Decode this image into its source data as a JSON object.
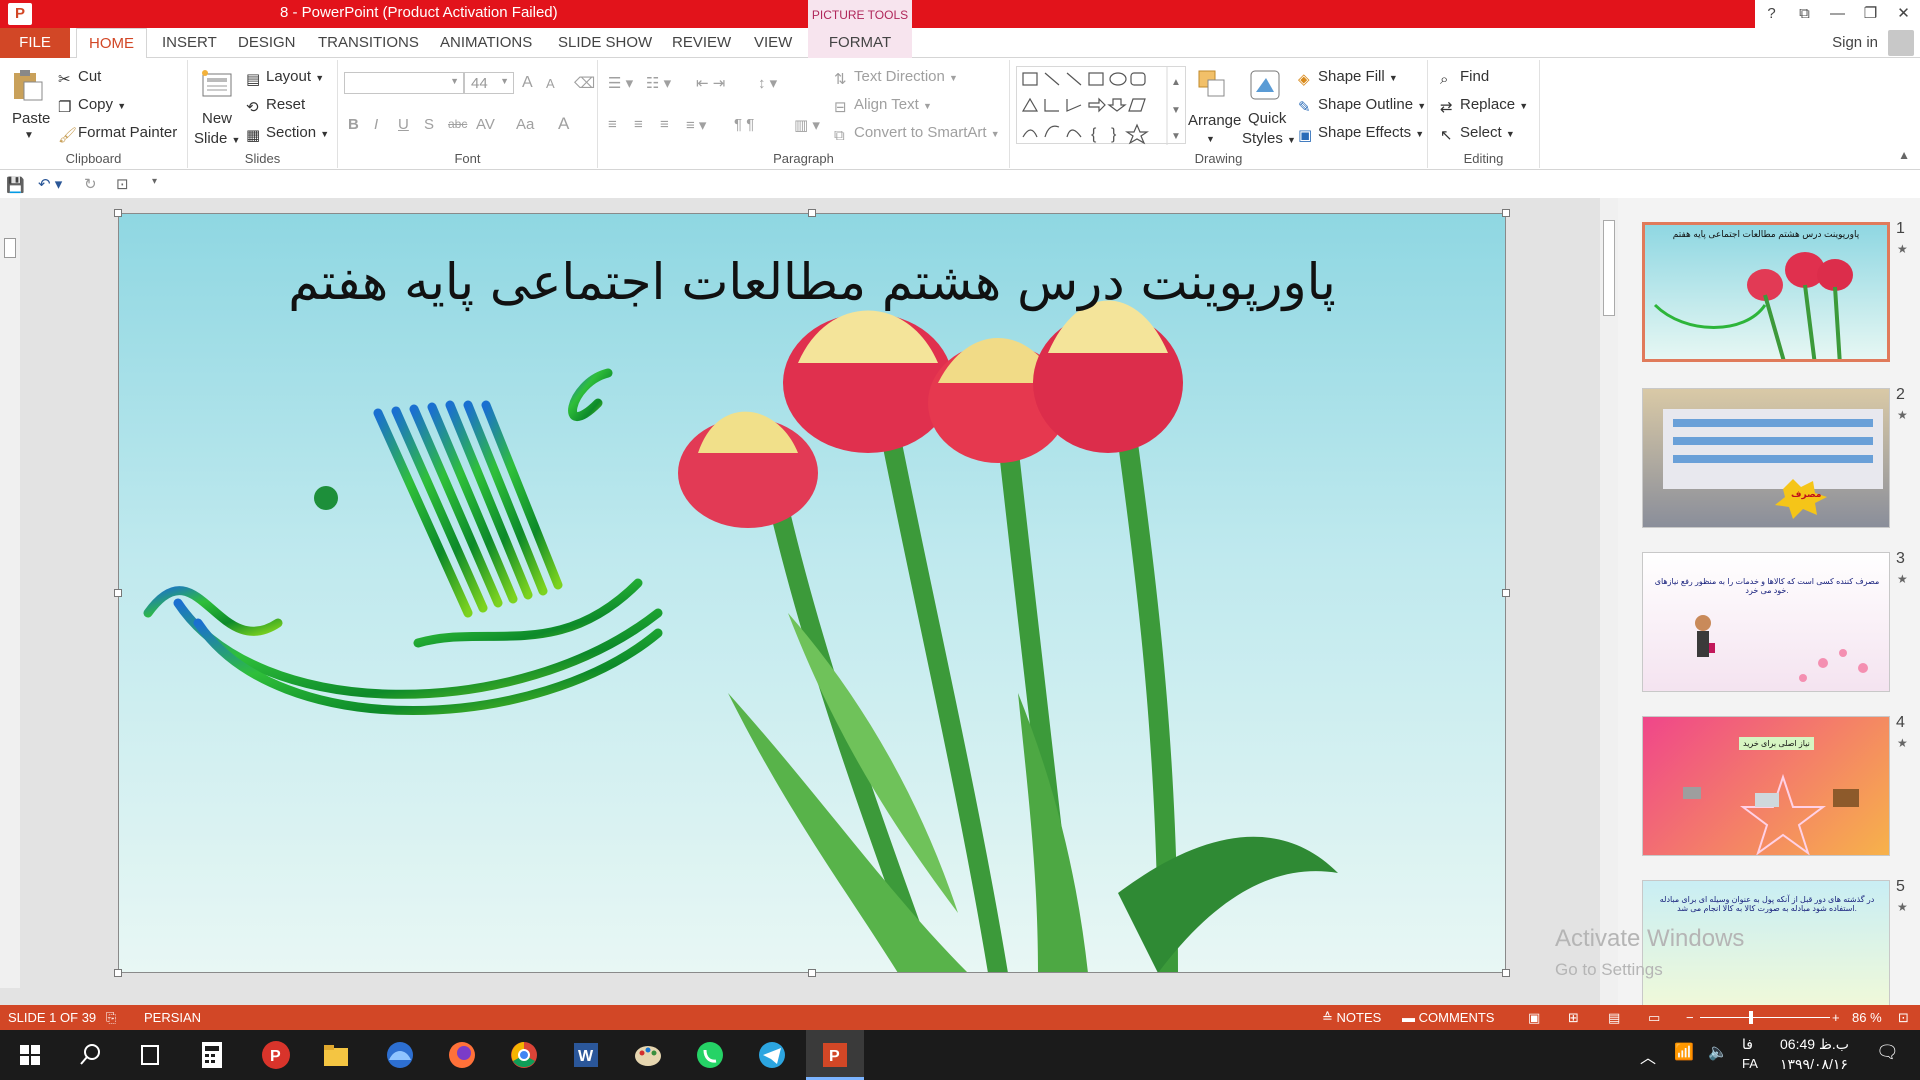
{
  "window": {
    "title": "8 -  PowerPoint (Product Activation Failed)",
    "context_tab": "PICTURE TOOLS",
    "help": "?",
    "restore_ribbon": "⧉",
    "minimize": "—",
    "maximize": "❐",
    "close": "✕"
  },
  "tabs": [
    "FILE",
    "HOME",
    "INSERT",
    "DESIGN",
    "TRANSITIONS",
    "ANIMATIONS",
    "SLIDE SHOW",
    "REVIEW",
    "VIEW",
    "FORMAT"
  ],
  "signin": "Sign in",
  "ribbon": {
    "clipboard": {
      "paste": "Paste",
      "cut": "Cut",
      "copy": "Copy",
      "format_painter": "Format Painter",
      "label": "Clipboard"
    },
    "slides": {
      "new_slide_1": "New",
      "new_slide_2": "Slide",
      "layout": "Layout",
      "reset": "Reset",
      "section": "Section",
      "label": "Slides"
    },
    "font": {
      "size": "44",
      "label": "Font",
      "bold": "B",
      "italic": "I",
      "underline": "U",
      "shadow": "S",
      "strike": "abc",
      "spacing": "AV",
      "case": "Aa",
      "color": "A",
      "grow": "A",
      "shrink": "A"
    },
    "paragraph": {
      "text_direction": "Text Direction",
      "align_text": "Align Text",
      "convert_smartart": "Convert to SmartArt",
      "label": "Paragraph"
    },
    "drawing": {
      "arrange": "Arrange",
      "quick_styles_1": "Quick",
      "quick_styles_2": "Styles",
      "shape_fill": "Shape Fill",
      "shape_outline": "Shape Outline",
      "shape_effects": "Shape Effects",
      "label": "Drawing"
    },
    "editing": {
      "find": "Find",
      "replace": "Replace",
      "select": "Select",
      "label": "Editing"
    }
  },
  "slide": {
    "title": "پاورپوینت درس هشتم مطالعات اجتماعی پایه هفتم"
  },
  "thumbnails": [
    {
      "num": "1",
      "caption": "پاورپوینت درس هشتم مطالعات اجتماعی پایه هفتم"
    },
    {
      "num": "2",
      "caption": "مصرف"
    },
    {
      "num": "3",
      "caption": "مصرف کننده کسی است که کالاها و خدمات را به منظور رفع نیازهای خود می خرد."
    },
    {
      "num": "4",
      "caption": "نیاز اصلی برای خرید"
    },
    {
      "num": "5",
      "caption": "در گذشته های دور قبل از آنکه پول به عنوان وسیله ای برای مبادله استفاده شود مبادله به صورت کالا به کالا انجام می شد."
    }
  ],
  "watermark": {
    "line1": "Activate Windows",
    "line2": "Go to Settings"
  },
  "status": {
    "slide_count": "SLIDE 1 OF 39",
    "language": "PERSIAN",
    "notes": "NOTES",
    "comments": "COMMENTS",
    "zoom": "86 %"
  },
  "taskbar": {
    "time": "06:49 ب.ظ",
    "date": "۱۳۹۹/۰۸/۱۶",
    "lang_1": "فا",
    "lang_2": "FA"
  },
  "colors": {
    "accent": "#d24726",
    "titlebar": "#e2131b"
  }
}
